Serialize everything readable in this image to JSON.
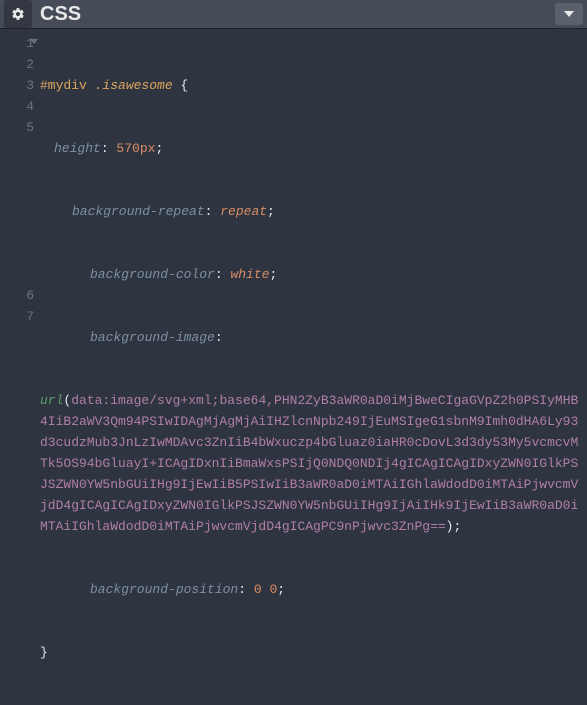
{
  "header": {
    "title": "CSS",
    "gear_tooltip": "Settings",
    "collapse_tooltip": "Collapse"
  },
  "gutter": [
    1,
    2,
    3,
    4,
    5,
    6,
    7
  ],
  "code": {
    "line1": {
      "selector_id": "#mydiv ",
      "selector_class": ".isawesome",
      "brace": " {"
    },
    "line2": {
      "prop": "height",
      "colon": ": ",
      "num": "570px",
      "semi": ";"
    },
    "line3": {
      "prop": "background-repeat",
      "colon": ": ",
      "val": "repeat",
      "semi": ";"
    },
    "line4": {
      "prop": "background-color",
      "colon": ": ",
      "val": "white",
      "semi": ";"
    },
    "line5": {
      "prop": "background-image",
      "colon": ":",
      "fn": "url",
      "open": "(",
      "data": "data:image/svg+xml;base64,PHN2ZyB3aWR0aD0iMjBweCIgaGVpZ2h0PSIyMHB4IiB2aWV3Qm94PSIwIDAgMjAgMjAiIHZlcnNpb249IjEuMSIgeG1sbnM9Imh0dHA6Ly93d3cudzMub3JnLzIwMDAvc3ZnIiB4bWxuczp4bGluaz0iaHR0cDovL3d3dy53My5vcmcvMTk5OS94bGluayI+ICAgIDxnIiBmaWxsPSIjQ0NDQ0NDIj4gICAgICAgIDxyZWN0IGlkPSJSZWN0YW5nbGUiIHg9IjEwIiB5PSIwIiB3aWR0aD0iMTAiIGhlaWdodD0iMTAiPjwvcmVjdD4gICAgICAgIDxyZWN0IGlkPSJSZWN0YW5nbGUiIHg9IjAiIHk9IjEwIiB3aWR0aD0iMTAiIGhlaWdodD0iMTAiPjwvcmVjdD4gICAgPC9nPjwvc3ZnPg==",
      "close": ");"
    },
    "line6": {
      "prop": "background-position",
      "colon": ": ",
      "v1": "0",
      "sp": " ",
      "v2": "0",
      "semi": ";"
    },
    "line7": {
      "brace": "}"
    }
  }
}
